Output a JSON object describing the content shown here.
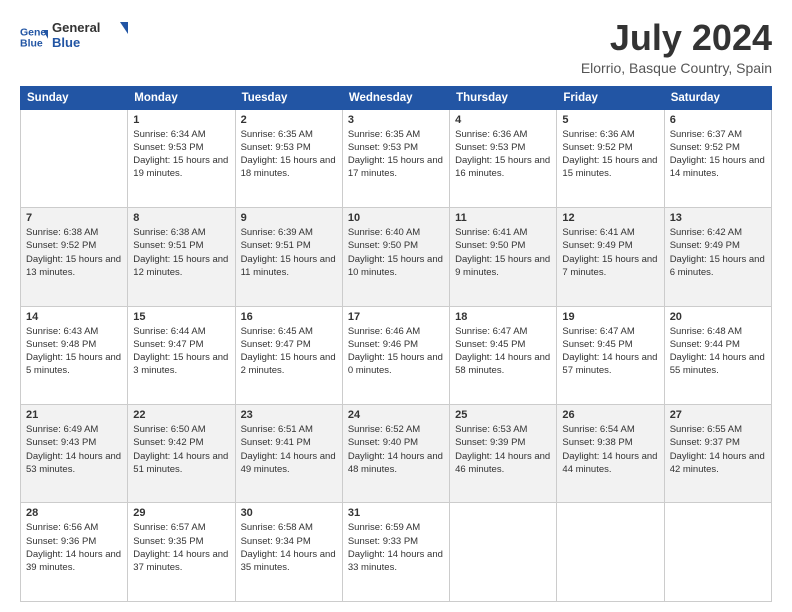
{
  "logo": {
    "line1": "General",
    "line2": "Blue"
  },
  "title": "July 2024",
  "subtitle": "Elorrio, Basque Country, Spain",
  "weekdays": [
    "Sunday",
    "Monday",
    "Tuesday",
    "Wednesday",
    "Thursday",
    "Friday",
    "Saturday"
  ],
  "weeks": [
    [
      {
        "day": "",
        "sunrise": "",
        "sunset": "",
        "daylight": ""
      },
      {
        "day": "1",
        "sunrise": "Sunrise: 6:34 AM",
        "sunset": "Sunset: 9:53 PM",
        "daylight": "Daylight: 15 hours and 19 minutes."
      },
      {
        "day": "2",
        "sunrise": "Sunrise: 6:35 AM",
        "sunset": "Sunset: 9:53 PM",
        "daylight": "Daylight: 15 hours and 18 minutes."
      },
      {
        "day": "3",
        "sunrise": "Sunrise: 6:35 AM",
        "sunset": "Sunset: 9:53 PM",
        "daylight": "Daylight: 15 hours and 17 minutes."
      },
      {
        "day": "4",
        "sunrise": "Sunrise: 6:36 AM",
        "sunset": "Sunset: 9:53 PM",
        "daylight": "Daylight: 15 hours and 16 minutes."
      },
      {
        "day": "5",
        "sunrise": "Sunrise: 6:36 AM",
        "sunset": "Sunset: 9:52 PM",
        "daylight": "Daylight: 15 hours and 15 minutes."
      },
      {
        "day": "6",
        "sunrise": "Sunrise: 6:37 AM",
        "sunset": "Sunset: 9:52 PM",
        "daylight": "Daylight: 15 hours and 14 minutes."
      }
    ],
    [
      {
        "day": "7",
        "sunrise": "Sunrise: 6:38 AM",
        "sunset": "Sunset: 9:52 PM",
        "daylight": "Daylight: 15 hours and 13 minutes."
      },
      {
        "day": "8",
        "sunrise": "Sunrise: 6:38 AM",
        "sunset": "Sunset: 9:51 PM",
        "daylight": "Daylight: 15 hours and 12 minutes."
      },
      {
        "day": "9",
        "sunrise": "Sunrise: 6:39 AM",
        "sunset": "Sunset: 9:51 PM",
        "daylight": "Daylight: 15 hours and 11 minutes."
      },
      {
        "day": "10",
        "sunrise": "Sunrise: 6:40 AM",
        "sunset": "Sunset: 9:50 PM",
        "daylight": "Daylight: 15 hours and 10 minutes."
      },
      {
        "day": "11",
        "sunrise": "Sunrise: 6:41 AM",
        "sunset": "Sunset: 9:50 PM",
        "daylight": "Daylight: 15 hours and 9 minutes."
      },
      {
        "day": "12",
        "sunrise": "Sunrise: 6:41 AM",
        "sunset": "Sunset: 9:49 PM",
        "daylight": "Daylight: 15 hours and 7 minutes."
      },
      {
        "day": "13",
        "sunrise": "Sunrise: 6:42 AM",
        "sunset": "Sunset: 9:49 PM",
        "daylight": "Daylight: 15 hours and 6 minutes."
      }
    ],
    [
      {
        "day": "14",
        "sunrise": "Sunrise: 6:43 AM",
        "sunset": "Sunset: 9:48 PM",
        "daylight": "Daylight: 15 hours and 5 minutes."
      },
      {
        "day": "15",
        "sunrise": "Sunrise: 6:44 AM",
        "sunset": "Sunset: 9:47 PM",
        "daylight": "Daylight: 15 hours and 3 minutes."
      },
      {
        "day": "16",
        "sunrise": "Sunrise: 6:45 AM",
        "sunset": "Sunset: 9:47 PM",
        "daylight": "Daylight: 15 hours and 2 minutes."
      },
      {
        "day": "17",
        "sunrise": "Sunrise: 6:46 AM",
        "sunset": "Sunset: 9:46 PM",
        "daylight": "Daylight: 15 hours and 0 minutes."
      },
      {
        "day": "18",
        "sunrise": "Sunrise: 6:47 AM",
        "sunset": "Sunset: 9:45 PM",
        "daylight": "Daylight: 14 hours and 58 minutes."
      },
      {
        "day": "19",
        "sunrise": "Sunrise: 6:47 AM",
        "sunset": "Sunset: 9:45 PM",
        "daylight": "Daylight: 14 hours and 57 minutes."
      },
      {
        "day": "20",
        "sunrise": "Sunrise: 6:48 AM",
        "sunset": "Sunset: 9:44 PM",
        "daylight": "Daylight: 14 hours and 55 minutes."
      }
    ],
    [
      {
        "day": "21",
        "sunrise": "Sunrise: 6:49 AM",
        "sunset": "Sunset: 9:43 PM",
        "daylight": "Daylight: 14 hours and 53 minutes."
      },
      {
        "day": "22",
        "sunrise": "Sunrise: 6:50 AM",
        "sunset": "Sunset: 9:42 PM",
        "daylight": "Daylight: 14 hours and 51 minutes."
      },
      {
        "day": "23",
        "sunrise": "Sunrise: 6:51 AM",
        "sunset": "Sunset: 9:41 PM",
        "daylight": "Daylight: 14 hours and 49 minutes."
      },
      {
        "day": "24",
        "sunrise": "Sunrise: 6:52 AM",
        "sunset": "Sunset: 9:40 PM",
        "daylight": "Daylight: 14 hours and 48 minutes."
      },
      {
        "day": "25",
        "sunrise": "Sunrise: 6:53 AM",
        "sunset": "Sunset: 9:39 PM",
        "daylight": "Daylight: 14 hours and 46 minutes."
      },
      {
        "day": "26",
        "sunrise": "Sunrise: 6:54 AM",
        "sunset": "Sunset: 9:38 PM",
        "daylight": "Daylight: 14 hours and 44 minutes."
      },
      {
        "day": "27",
        "sunrise": "Sunrise: 6:55 AM",
        "sunset": "Sunset: 9:37 PM",
        "daylight": "Daylight: 14 hours and 42 minutes."
      }
    ],
    [
      {
        "day": "28",
        "sunrise": "Sunrise: 6:56 AM",
        "sunset": "Sunset: 9:36 PM",
        "daylight": "Daylight: 14 hours and 39 minutes."
      },
      {
        "day": "29",
        "sunrise": "Sunrise: 6:57 AM",
        "sunset": "Sunset: 9:35 PM",
        "daylight": "Daylight: 14 hours and 37 minutes."
      },
      {
        "day": "30",
        "sunrise": "Sunrise: 6:58 AM",
        "sunset": "Sunset: 9:34 PM",
        "daylight": "Daylight: 14 hours and 35 minutes."
      },
      {
        "day": "31",
        "sunrise": "Sunrise: 6:59 AM",
        "sunset": "Sunset: 9:33 PM",
        "daylight": "Daylight: 14 hours and 33 minutes."
      },
      {
        "day": "",
        "sunrise": "",
        "sunset": "",
        "daylight": ""
      },
      {
        "day": "",
        "sunrise": "",
        "sunset": "",
        "daylight": ""
      },
      {
        "day": "",
        "sunrise": "",
        "sunset": "",
        "daylight": ""
      }
    ]
  ]
}
